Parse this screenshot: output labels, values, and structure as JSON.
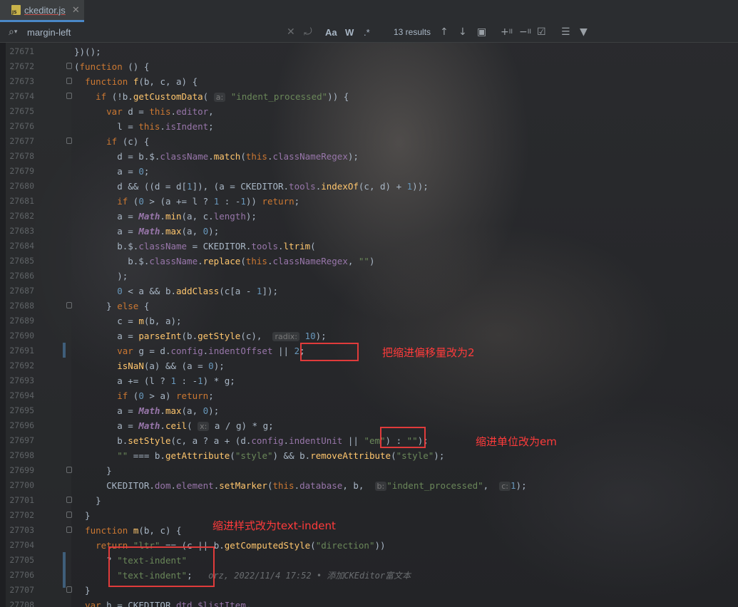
{
  "tab": {
    "label": "ckeditor.js",
    "icon_text": "JS"
  },
  "search": {
    "query": "margin-left",
    "results": "13 results",
    "case_label": "Aa",
    "word_label": "W",
    "regex_label": ".*"
  },
  "lines": [
    {
      "no": "27671",
      "html": "<span class='k'></span>})();"
    },
    {
      "no": "27672",
      "html": "(<span class='k'>function</span> () {"
    },
    {
      "no": "27673",
      "html": "  <span class='k'>function</span> <span class='f'>f</span>(b, c, a) {"
    },
    {
      "no": "27674",
      "html": "    <span class='k'>if</span> (!b.<span class='f'>getCustomData</span>( <span class='hint'>a:</span> <span class='s'>\"indent_processed\"</span>)) {"
    },
    {
      "no": "27675",
      "html": "      <span class='k'>var</span> d = <span class='k'>this</span>.<span class='p'>editor</span>,"
    },
    {
      "no": "27676",
      "html": "        l = <span class='k'>this</span>.<span class='p'>isIndent</span>;"
    },
    {
      "no": "27677",
      "html": "      <span class='k'>if</span> (c) {"
    },
    {
      "no": "27678",
      "html": "        d = b.$.<span class='p'>className</span>.<span class='f'>match</span>(<span class='k'>this</span>.<span class='p'>classNameRegex</span>);"
    },
    {
      "no": "27679",
      "html": "        a = <span class='n'>0</span>;"
    },
    {
      "no": "27680",
      "html": "        d &amp;&amp; ((d = d[<span class='n'>1</span>]), (a = CKEDITOR.<span class='p'>tools</span>.<span class='f'>indexOf</span>(c, d) + <span class='n'>1</span>));"
    },
    {
      "no": "27681",
      "html": "        <span class='k'>if</span> (<span class='n'>0</span> &gt; (a += l ? <span class='n'>1</span> : -<span class='n'>1</span>)) <span class='k'>return</span>;"
    },
    {
      "no": "27682",
      "html": "        a = <span class='it'>Math</span>.<span class='f'>min</span>(a, c.<span class='p'>length</span>);"
    },
    {
      "no": "27683",
      "html": "        a = <span class='it'>Math</span>.<span class='f'>max</span>(a, <span class='n'>0</span>);"
    },
    {
      "no": "27684",
      "html": "        b.$.<span class='p'>className</span> = CKEDITOR.<span class='p'>tools</span>.<span class='f'>ltrim</span>("
    },
    {
      "no": "27685",
      "html": "          b.$.<span class='p'>className</span>.<span class='f'>replace</span>(<span class='k'>this</span>.<span class='p'>classNameRegex</span>, <span class='s'>\"\"</span>)"
    },
    {
      "no": "27686",
      "html": "        );"
    },
    {
      "no": "27687",
      "html": "        <span class='n'>0</span> &lt; a &amp;&amp; b.<span class='f'>addClass</span>(c[a - <span class='n'>1</span>]);"
    },
    {
      "no": "27688",
      "html": "      } <span class='k'>else</span> {"
    },
    {
      "no": "27689",
      "html": "        c = <span class='f'>m</span>(b, a);"
    },
    {
      "no": "27690",
      "html": "        a = <span class='f'>parseInt</span>(b.<span class='f'>getStyle</span>(c),  <span class='hint'>radix:</span> <span class='n'>10</span>);"
    },
    {
      "no": "27691",
      "html": "        <span class='k'>var</span> g = d.<span class='p'>config</span>.<span class='p'>indentOffset</span> || <span class='n'>2</span>;"
    },
    {
      "no": "27692",
      "html": "        <span class='f'>isNaN</span>(a) &amp;&amp; (a = <span class='n'>0</span>);"
    },
    {
      "no": "27693",
      "html": "        a += (l ? <span class='n'>1</span> : -<span class='n'>1</span>) * g;"
    },
    {
      "no": "27694",
      "html": "        <span class='k'>if</span> (<span class='n'>0</span> &gt; a) <span class='k'>return</span>;"
    },
    {
      "no": "27695",
      "html": "        a = <span class='it'>Math</span>.<span class='f'>max</span>(a, <span class='n'>0</span>);"
    },
    {
      "no": "27696",
      "html": "        a = <span class='it'>Math</span>.<span class='f'>ceil</span>( <span class='hint'>x:</span> a / g) * g;"
    },
    {
      "no": "27697",
      "html": "        b.<span class='f'>setStyle</span>(c, a ? a + (d.<span class='p'>config</span>.<span class='p'>indentUnit</span> || <span class='s'>\"em\"</span>) : <span class='s'>\"\"</span>);"
    },
    {
      "no": "27698",
      "html": "        <span class='s'>\"\"</span> === b.<span class='f'>getAttribute</span>(<span class='s'>\"style\"</span>) &amp;&amp; b.<span class='f'>removeAttribute</span>(<span class='s'>\"style\"</span>);"
    },
    {
      "no": "27699",
      "html": "      }"
    },
    {
      "no": "27700",
      "html": "      CKEDITOR.<span class='p'>dom</span>.<span class='p'>element</span>.<span class='f'>setMarker</span>(<span class='k'>this</span>.<span class='p'>database</span>, b,  <span class='hint'>b:</span><span class='s'>\"indent_processed\"</span>,  <span class='hint'>c:</span><span class='n'>1</span>);"
    },
    {
      "no": "27701",
      "html": "    }"
    },
    {
      "no": "27702",
      "html": "  }"
    },
    {
      "no": "27703",
      "html": "  <span class='k'>function</span> <span class='f'>m</span>(b, c) {"
    },
    {
      "no": "27704",
      "html": "    <span class='k'>return</span> <span class='s'>\"ltr\"</span> == (c || b.<span class='f'>getComputedStyle</span>(<span class='s'>\"direction\"</span>))"
    },
    {
      "no": "27705",
      "html": "      ? <span class='s'>\"text-indent\"</span>"
    },
    {
      "no": "27706",
      "html": "      : <span class='s'>\"text-indent\"</span>;   <span class='blame'>orz, 2022/11/4 17:52 • 添加CKEditor富文本</span>"
    },
    {
      "no": "27707",
      "html": "  }"
    },
    {
      "no": "27708",
      "html": "  <span class='k'>var</span> h = CKEDITOR.<span class='p'>dtd</span>.<span class='p'>$listItem</span>,"
    }
  ],
  "annotations": {
    "offset": "把缩进偏移量改为2",
    "unit": "缩进单位改为em",
    "style": "缩进样式改为text-indent"
  }
}
